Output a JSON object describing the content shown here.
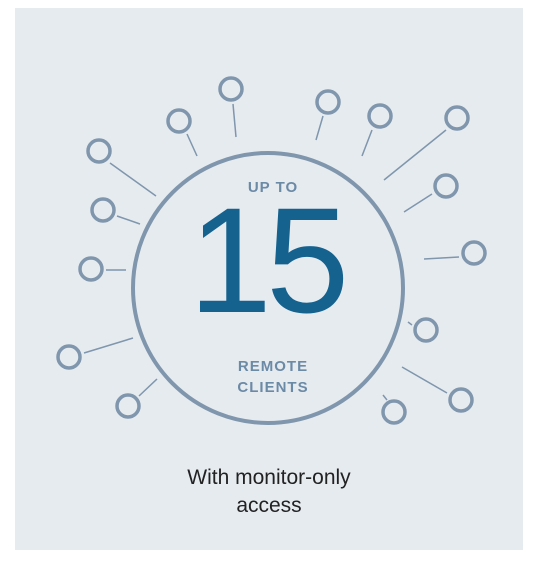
{
  "colors": {
    "background": "#e6ebf0",
    "ring": "#7f96ad",
    "number": "#15628f",
    "label": "#6b8aa6",
    "caption": "#222222"
  },
  "center": {
    "top_label": "UP TO",
    "number": "15",
    "bottom_line1": "REMOTE",
    "bottom_line2": "CLIENTS"
  },
  "caption": {
    "line1": "With monitor-only",
    "line2": "access"
  },
  "client_nodes": 15
}
